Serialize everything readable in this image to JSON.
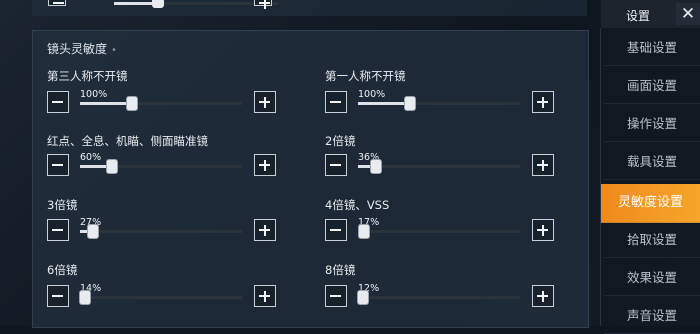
{
  "section_title": "镜头灵敏度",
  "section_marker": "•",
  "settings": [
    {
      "label": "第三人称不开镜",
      "value": 100,
      "value_text": "100%",
      "fill": 0.32
    },
    {
      "label": "第一人称不开镜",
      "value": 100,
      "value_text": "100%",
      "fill": 0.32
    },
    {
      "label": "红点、全息、机瞄、侧面瞄准镜",
      "value": 60,
      "value_text": "60%",
      "fill": 0.2
    },
    {
      "label": "2倍镜",
      "value": 36,
      "value_text": "36%",
      "fill": 0.11
    },
    {
      "label": "3倍镜",
      "value": 27,
      "value_text": "27%",
      "fill": 0.08
    },
    {
      "label": "4倍镜、VSS",
      "value": 17,
      "value_text": "17%",
      "fill": 0.04
    },
    {
      "label": "6倍镜",
      "value": 14,
      "value_text": "14%",
      "fill": 0.03
    },
    {
      "label": "8倍镜",
      "value": 12,
      "value_text": "12%",
      "fill": 0.03
    }
  ],
  "menu": {
    "title": "设置",
    "close_icon": "close-icon",
    "items": [
      {
        "label": "基础设置",
        "active": false
      },
      {
        "label": "画面设置",
        "active": false
      },
      {
        "label": "操作设置",
        "active": false
      },
      {
        "label": "载具设置",
        "active": false
      },
      {
        "label": "灵敏度设置",
        "active": true
      },
      {
        "label": "拾取设置",
        "active": false
      },
      {
        "label": "效果设置",
        "active": false
      },
      {
        "label": "声音设置",
        "active": false
      }
    ]
  },
  "colors": {
    "accent": "#f39a22",
    "panel": "#223040",
    "text": "#e6eaee"
  }
}
